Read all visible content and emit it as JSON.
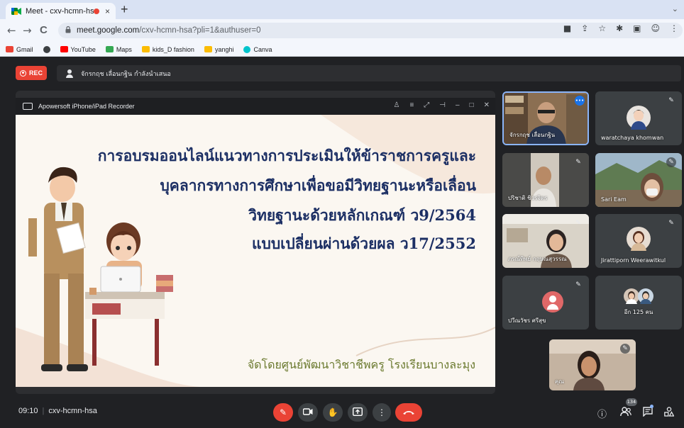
{
  "browser": {
    "tab_title": "Meet - cxv-hcmn-hsa",
    "tab_close": "×",
    "new_tab": "+",
    "tabs_menu": "⌄",
    "back": "←",
    "forward": "→",
    "reload": "C",
    "url_host": "meet.google.com",
    "url_path": "/cxv-hcmn-hsa?pli=1&authuser=0",
    "toolbar_icons": [
      "video-icon",
      "share-icon",
      "star-icon",
      "extensions-icon",
      "sidepanel-icon",
      "profile-icon",
      "menu-icon"
    ],
    "bookmarks": [
      {
        "label": "Gmail",
        "icon": "gmail-icon",
        "color": "#ea4335"
      },
      {
        "label": "",
        "icon": "chrome-icon",
        "color": "#3c4043"
      },
      {
        "label": "YouTube",
        "icon": "youtube-icon",
        "color": "#ff0000"
      },
      {
        "label": "Maps",
        "icon": "maps-icon",
        "color": "#34a853"
      },
      {
        "label": "kids_D fashion",
        "icon": "folder-icon",
        "color": "#fbbc04"
      },
      {
        "label": "yanghi",
        "icon": "folder-icon",
        "color": "#fbbc04"
      },
      {
        "label": "Canva",
        "icon": "canva-icon",
        "color": "#00c4cc"
      }
    ]
  },
  "meet": {
    "rec_label": "REC",
    "presenter_text": "จักรกฤช เลื่อนกฐิน กำลังนำเสนอ",
    "recorder_title": "Apowersoft iPhone/iPad Recorder",
    "recorder_controls": [
      "person-icon",
      "list-icon",
      "expand-icon",
      "pin-icon",
      "minimize-icon",
      "close-icon"
    ],
    "slide": {
      "lines": [
        "การอบรมออนไลน์แนวทางการประเมินให้ข้าราชการครูและ",
        "บุคลากรทางการศึกษาเพื่อขอมีวิทยฐานะหรือเลื่อน",
        "วิทยฐานะด้วยหลักเกณฑ์ ว9/2564",
        "แบบเปลี่ยนผ่านด้วยผล ว17/2552"
      ],
      "footer": "จัดโดยศูนย์พัฒนาวิชาชีพครู  โรงเรียนบางละมุง"
    },
    "participants": [
      {
        "name": "จักรกฤช เลื่อนกฐิน",
        "state": "speaking",
        "kind": "video"
      },
      {
        "name": "waratchaya khomwan",
        "state": "muted",
        "kind": "photo"
      },
      {
        "name": "ปริชาติ ชิวรจิตร",
        "state": "muted",
        "kind": "video"
      },
      {
        "name": "Sari Eam",
        "state": "muted",
        "kind": "video"
      },
      {
        "name": "ภรณ์ทิพย์ กฤษณสุวรรณ",
        "state": "muted",
        "kind": "video"
      },
      {
        "name": "Jirattiporn Weerawitkul",
        "state": "muted",
        "kind": "photo"
      },
      {
        "name": "ปวีณวัชร ศรีสุข",
        "state": "muted",
        "kind": "avatar"
      },
      {
        "name": "อีก 125 คน",
        "state": "",
        "kind": "group"
      },
      {
        "name": "คุณ",
        "state": "muted",
        "kind": "self"
      }
    ],
    "meeting_time": "09:10",
    "meeting_code": "cxv-hcmn-hsa",
    "controls": [
      "mic-off-icon",
      "camera-icon",
      "raise-hand-icon",
      "present-icon",
      "more-options-icon",
      "leave-call-icon"
    ],
    "right_icons": [
      "info-icon",
      "people-icon",
      "chat-icon",
      "activities-icon"
    ],
    "people_count": "134",
    "colors": {
      "rec": "#ea4335",
      "accent": "#8ab4f8",
      "bg": "#202124",
      "tile": "#3c4043"
    }
  }
}
